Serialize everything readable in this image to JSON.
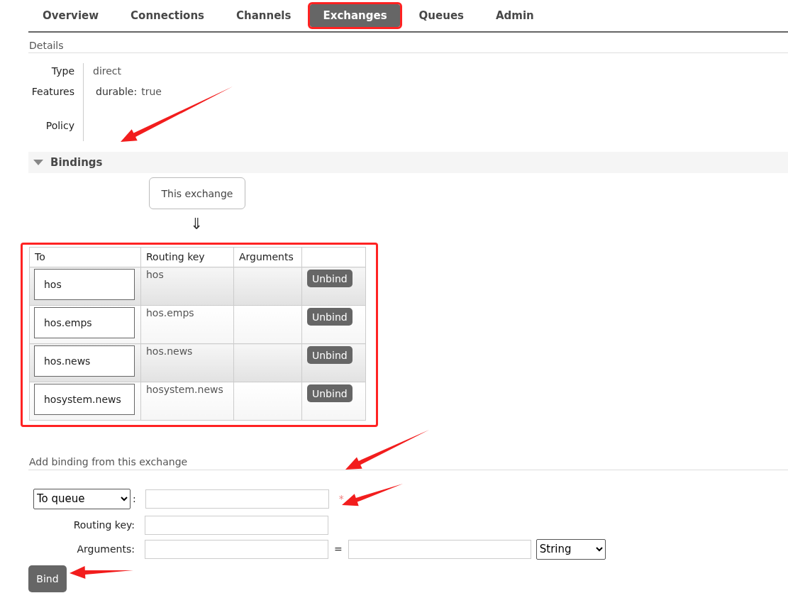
{
  "tabs": [
    {
      "label": "Overview",
      "selected": false
    },
    {
      "label": "Connections",
      "selected": false
    },
    {
      "label": "Channels",
      "selected": false
    },
    {
      "label": "Exchanges",
      "selected": true
    },
    {
      "label": "Queues",
      "selected": false
    },
    {
      "label": "Admin",
      "selected": false
    }
  ],
  "details": {
    "title": "Details",
    "type_label": "Type",
    "type_value": "direct",
    "features_label": "Features",
    "feature_name": "durable:",
    "feature_value": "true",
    "policy_label": "Policy"
  },
  "bindings": {
    "title": "Bindings",
    "expanded": true,
    "source": "This exchange",
    "flow_arrow": "⇓",
    "columns": [
      "To",
      "Routing key",
      "Arguments"
    ],
    "rows": [
      {
        "to": "hos",
        "routing_key": "hos",
        "action": "Unbind"
      },
      {
        "to": "hos.emps",
        "routing_key": "hos.emps",
        "action": "Unbind"
      },
      {
        "to": "hos.news",
        "routing_key": "hos.news",
        "action": "Unbind"
      },
      {
        "to": "hosystem.news",
        "routing_key": "hosystem.news",
        "action": "Unbind"
      }
    ]
  },
  "add_binding": {
    "title": "Add binding from this exchange",
    "destination_type": "To queue",
    "colon": ":",
    "required_mark": "*",
    "routing_key_label": "Routing key:",
    "arguments_label": "Arguments:",
    "equals": "=",
    "argument_type": "String",
    "submit": "Bind"
  }
}
